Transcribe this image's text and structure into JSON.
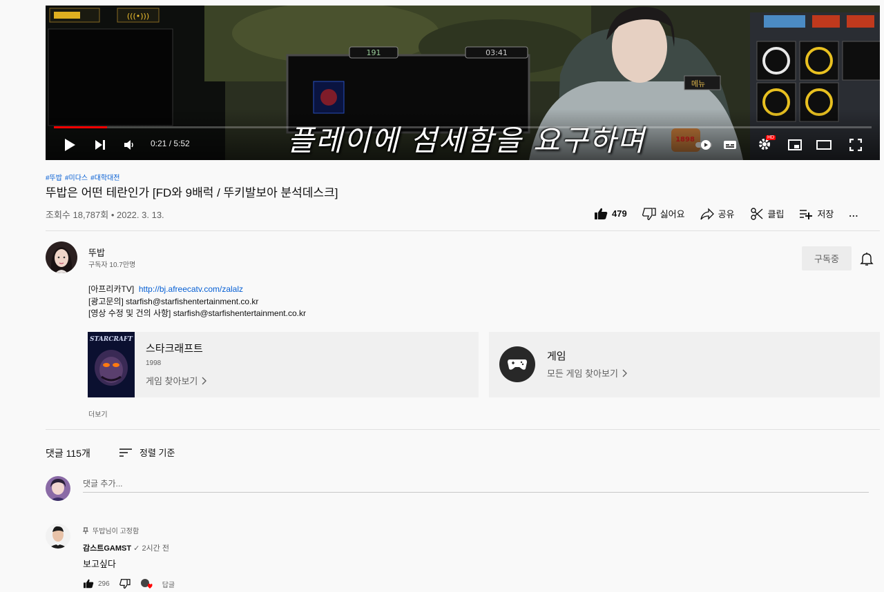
{
  "player": {
    "hud_counter_left": "191",
    "hud_counter_right": "03:41",
    "hud_menu_label": "메뉴",
    "hud_score": "1898",
    "subtitle": "플레이에 섬세함을 요구하며",
    "current_time": "0:21",
    "duration": "5:52",
    "time_display": "0:21 / 5:52",
    "progress_fraction": 0.065,
    "hd_badge": "HD",
    "accent_color": "#ff0000"
  },
  "video": {
    "hashtags": [
      "#뚜밥",
      "#미다스",
      "#대학대전"
    ],
    "title": "뚜밥은 어떤 테란인가 [FD와 9배럭 / 뚜키발보아 분석데스크]",
    "views_date": "조회수 18,787회 • 2022. 3. 13.",
    "like_count": "479",
    "dislike_label": "싫어요",
    "share_label": "공유",
    "clip_label": "클립",
    "save_label": "저장",
    "more_label": "..."
  },
  "channel": {
    "name": "뚜밥",
    "subscribers": "구독자 10.7만명",
    "subscribe_label": "구독중"
  },
  "description": {
    "line1_prefix": "[아프리카TV]",
    "line1_link": "http://bj.afreecatv.com/zalalz",
    "line2": "[광고문의] starfish@starfishentertainment.co.kr",
    "line3": "[영상 수정 및 건의 사항] starfish@starfishentertainment.co.kr",
    "more_label": "더보기"
  },
  "cards": {
    "game": {
      "thumb_text": "STARCRAFT",
      "title": "스타크래프트",
      "year": "1998",
      "link": "게임 찾아보기"
    },
    "category": {
      "title": "게임",
      "link": "모든 게임 찾아보기"
    }
  },
  "comments": {
    "count_label": "댓글 115개",
    "sort_label": "정렬 기준",
    "add_placeholder": "댓글 추가...",
    "items": [
      {
        "pinned_label": "뚜밥님이 고정함",
        "author": "감스트GAMST",
        "verified": "✓",
        "timestamp": "2시간 전",
        "text": "보고싶다",
        "likes": "296",
        "reply_label": "답글"
      }
    ]
  }
}
